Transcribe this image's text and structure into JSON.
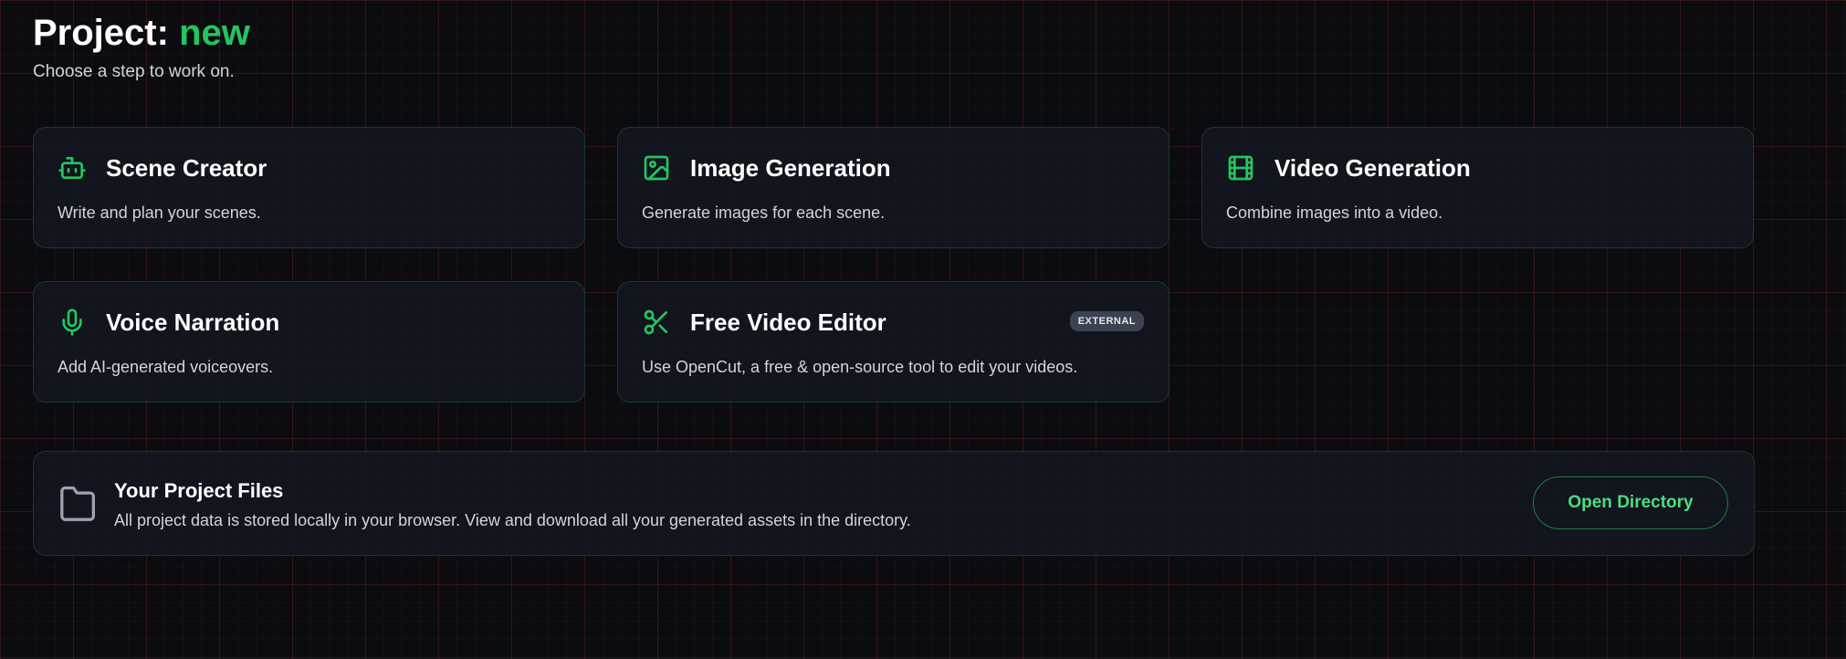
{
  "header": {
    "title_prefix": "Project:",
    "project_name": "new",
    "subtitle": "Choose a step to work on."
  },
  "cards": [
    {
      "title": "Scene Creator",
      "description": "Write and plan your scenes.",
      "icon": "robot-icon"
    },
    {
      "title": "Image Generation",
      "description": "Generate images for each scene.",
      "icon": "image-icon"
    },
    {
      "title": "Video Generation",
      "description": "Combine images into a video.",
      "icon": "film-icon"
    },
    {
      "title": "Voice Narration",
      "description": "Add AI-generated voiceovers.",
      "icon": "microphone-icon"
    },
    {
      "title": "Free Video Editor",
      "description": "Use OpenCut, a free & open-source tool to edit your videos.",
      "badge": "EXTERNAL",
      "icon": "scissors-icon"
    }
  ],
  "files": {
    "title": "Your Project Files",
    "description": "All project data is stored locally in your browser. View and download all your generated assets in the directory.",
    "button_label": "Open Directory",
    "icon": "folder-icon"
  },
  "colors": {
    "accent": "#22c55e",
    "background": "#0b0c10",
    "card": "#131620"
  }
}
